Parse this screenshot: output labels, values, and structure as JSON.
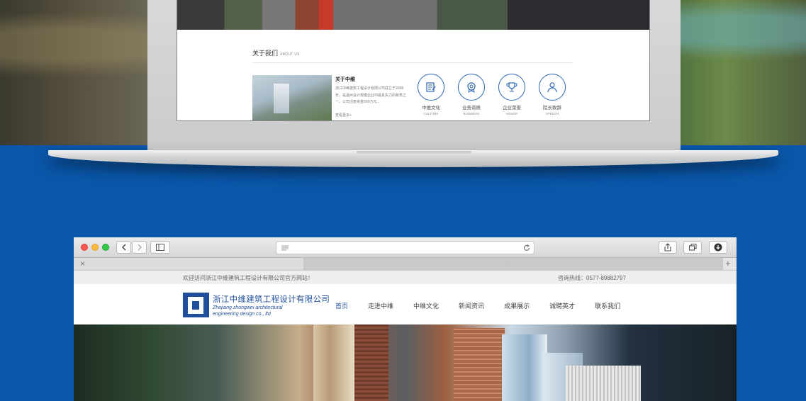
{
  "laptop_page": {
    "about_title": "关于我们",
    "about_title_en": "ABOUT US",
    "about_subtitle": "关于中维",
    "about_text": "浙江中维建筑工程设计有限公司成立于2008年，是温州设计规模企业中最具实力的新秀之一。公司注册资金500万元...",
    "read_more": "查看更多+",
    "items": [
      {
        "label": "中维文化",
        "en": "CULTURE",
        "icon": "document-edit-icon"
      },
      {
        "label": "业务资质",
        "en": "BUSINESS",
        "icon": "certificate-icon"
      },
      {
        "label": "企业荣誉",
        "en": "HONOR",
        "icon": "trophy-icon"
      },
      {
        "label": "院长致辞",
        "en": "SPEECH",
        "icon": "person-icon"
      }
    ]
  },
  "browser": {
    "close_tab": "×",
    "new_tab": "+"
  },
  "site": {
    "welcome": "欢迎访问浙江中维建筑工程设计有限公司官方网站！",
    "hotline": "咨询热线：0577-89882797",
    "company_cn": "浙江中维建筑工程设计有限公司",
    "company_en_1": "Zhejiang zhongwei architectural",
    "company_en_2": "engineering design co., ltd",
    "nav": [
      "首页",
      "走进中维",
      "中维文化",
      "新闻资讯",
      "成果展示",
      "诚聘英才",
      "联系我们"
    ],
    "accent": "#1f4f9a"
  }
}
